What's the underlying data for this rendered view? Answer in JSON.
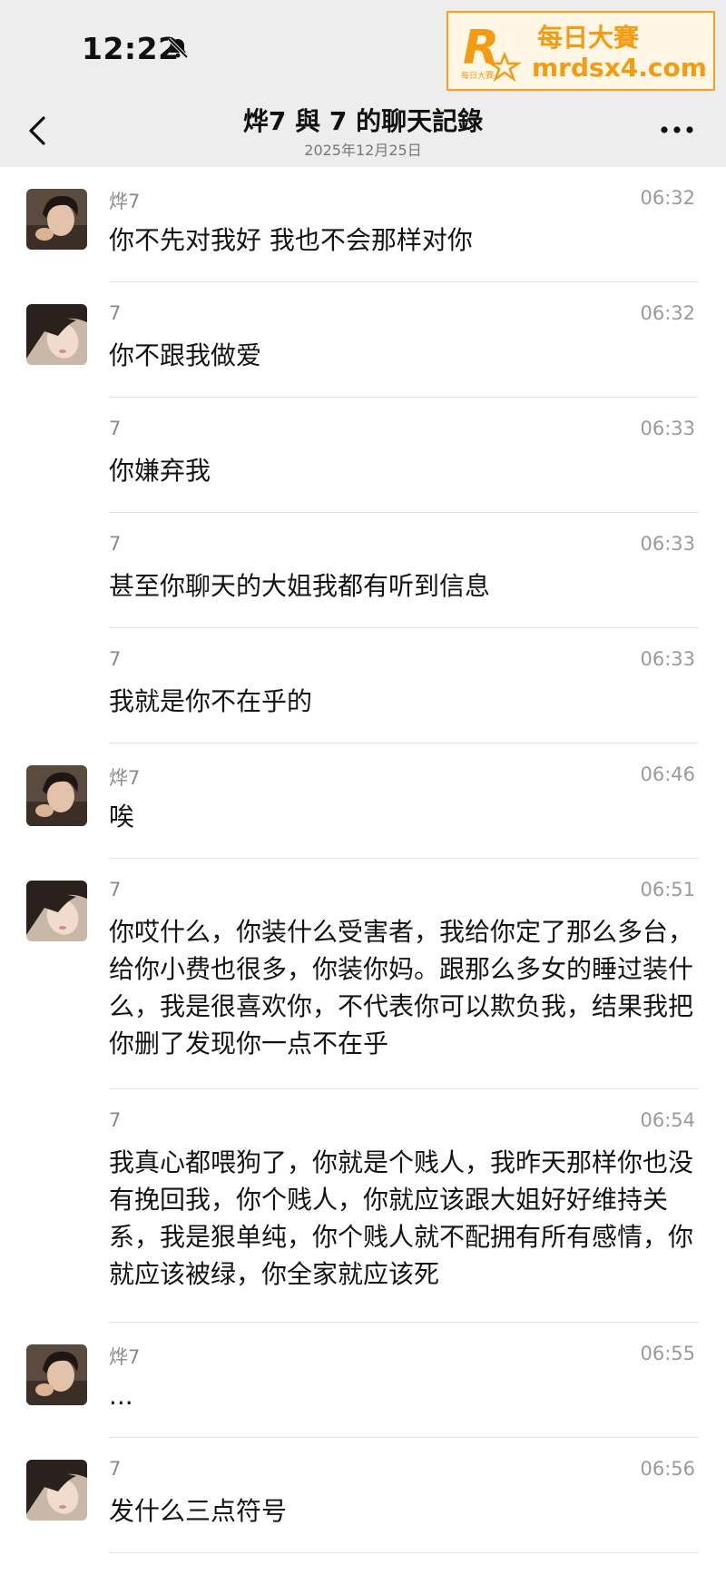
{
  "status": {
    "time": "12:22"
  },
  "watermark": {
    "logo_letter": "R",
    "logo_small": "每日大賽",
    "line1": "每日大賽",
    "line2": "mrdsx4.com"
  },
  "nav": {
    "title": "烨7 與 7 的聊天記錄",
    "subtitle": "2025年12月25日"
  },
  "messages": [
    {
      "sender": "烨7",
      "time": "06:32",
      "text": "你不先对我好 我也不会那样对你",
      "avatar": "male"
    },
    {
      "sender": "7",
      "time": "06:32",
      "text": "你不跟我做爱",
      "avatar": "female"
    },
    {
      "sender": "7",
      "time": "06:33",
      "text": "你嫌弃我",
      "avatar": ""
    },
    {
      "sender": "7",
      "time": "06:33",
      "text": "甚至你聊天的大姐我都有听到信息",
      "avatar": ""
    },
    {
      "sender": "7",
      "time": "06:33",
      "text": "我就是你不在乎的",
      "avatar": ""
    },
    {
      "sender": "烨7",
      "time": "06:46",
      "text": "唉",
      "avatar": "male"
    },
    {
      "sender": "7",
      "time": "06:51",
      "text": "你哎什么，你装什么受害者，我给你定了那么多台，给你小费也很多，你装你妈。跟那么多女的睡过装什么，我是很喜欢你，不代表你可以欺负我，结果我把你删了发现你一点不在乎",
      "avatar": "female"
    },
    {
      "sender": "7",
      "time": "06:54",
      "text": "我真心都喂狗了，你就是个贱人，我昨天那样你也没有挽回我，你个贱人，你就应该跟大姐好好维持关系，我是狠单纯，你个贱人就不配拥有所有感情，你就应该被绿，你全家就应该死",
      "avatar": ""
    },
    {
      "sender": "烨7",
      "time": "06:55",
      "text": "...",
      "avatar": "male"
    },
    {
      "sender": "7",
      "time": "06:56",
      "text": "发什么三点符号",
      "avatar": "female"
    }
  ]
}
